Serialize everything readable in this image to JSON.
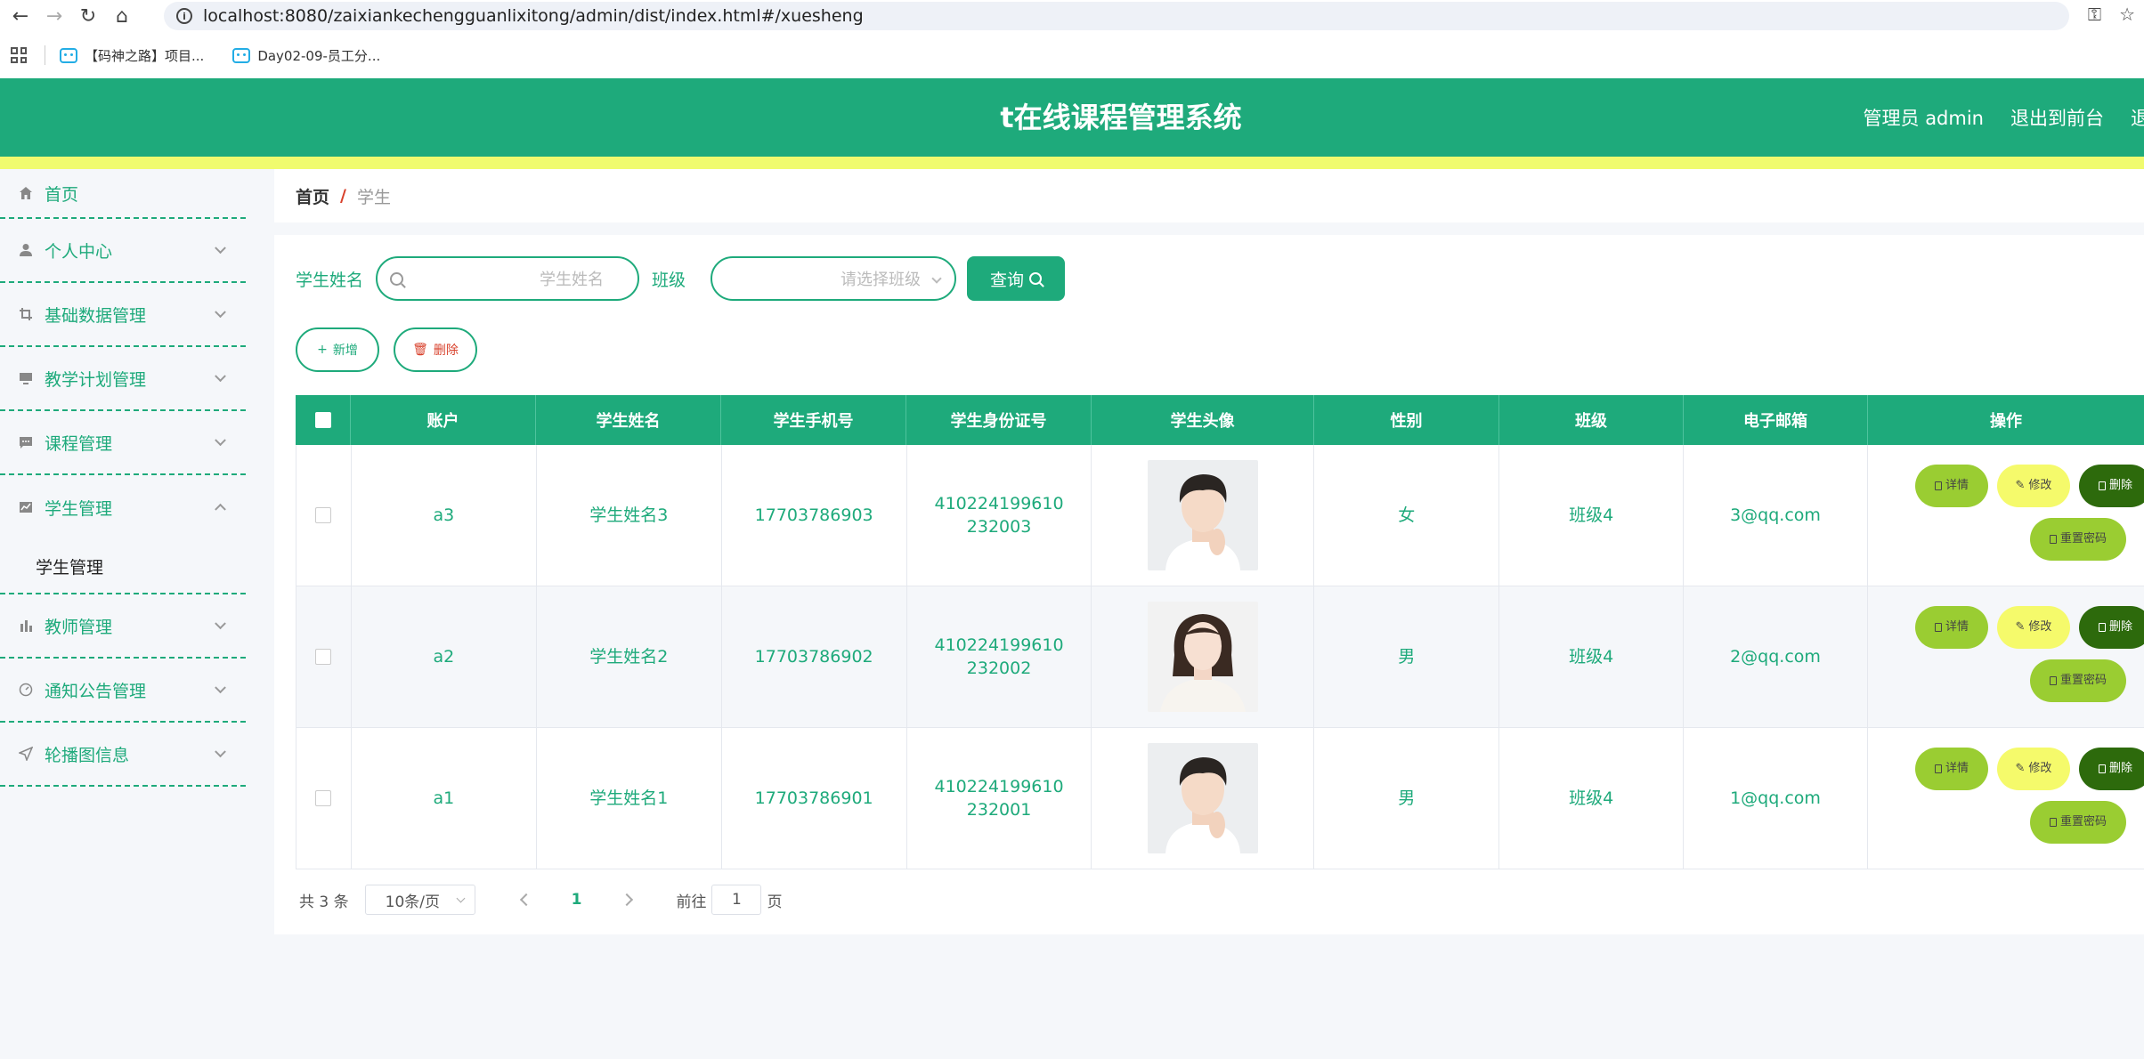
{
  "browser": {
    "url": "localhost:8080/zaixiankechengguanlixitong/admin/dist/index.html#/xuesheng",
    "bookmarks": [
      "【码神之路】项目...",
      "Day02-09-员工分..."
    ]
  },
  "header": {
    "title": "t在线课程管理系统",
    "user": "管理员 admin",
    "exit_front": "退出到前台",
    "exit": "退"
  },
  "sidebar": {
    "items": [
      {
        "label": "首页",
        "icon": "home-icon"
      },
      {
        "label": "个人中心",
        "icon": "user-icon"
      },
      {
        "label": "基础数据管理",
        "icon": "crop-icon"
      },
      {
        "label": "教学计划管理",
        "icon": "monitor-icon"
      },
      {
        "label": "课程管理",
        "icon": "chat-icon"
      },
      {
        "label": "学生管理",
        "icon": "chart-line-icon"
      },
      {
        "label": "教师管理",
        "icon": "bar-chart-icon"
      },
      {
        "label": "通知公告管理",
        "icon": "gauge-icon"
      },
      {
        "label": "轮播图信息",
        "icon": "location-icon"
      }
    ],
    "submenu": {
      "label": "学生管理"
    }
  },
  "breadcrumb": {
    "home": "首页",
    "sep": "/",
    "current": "学生"
  },
  "search": {
    "name_label": "学生姓名",
    "name_placeholder": "学生姓名",
    "class_label": "班级",
    "class_placeholder": "请选择班级",
    "query_label": "查询"
  },
  "actions": {
    "add": "新增",
    "delete": "删除"
  },
  "table": {
    "headers": [
      "账户",
      "学生姓名",
      "学生手机号",
      "学生身份证号",
      "学生头像",
      "性别",
      "班级",
      "电子邮箱",
      "操作"
    ],
    "rows": [
      {
        "account": "a3",
        "name": "学生姓名3",
        "phone": "17703786903",
        "id_card": "410224199610232003",
        "gender": "女",
        "class": "班级4",
        "email": "3@qq.com",
        "avatar": "male"
      },
      {
        "account": "a2",
        "name": "学生姓名2",
        "phone": "17703786902",
        "id_card": "410224199610232002",
        "gender": "男",
        "class": "班级4",
        "email": "2@qq.com",
        "avatar": "female"
      },
      {
        "account": "a1",
        "name": "学生姓名1",
        "phone": "17703786901",
        "id_card": "410224199610232001",
        "gender": "男",
        "class": "班级4",
        "email": "1@qq.com",
        "avatar": "male"
      }
    ],
    "op_labels": {
      "detail": "详情",
      "edit": "修改",
      "delete": "删除",
      "reset": "重置密码"
    }
  },
  "pagination": {
    "total": "共 3 条",
    "page_size": "10条/页",
    "current_page": "1",
    "goto_label": "前往",
    "goto_value": "1",
    "page_suffix": "页"
  },
  "colors": {
    "primary": "#1eaa7b",
    "accent_strip": "#f0fb6e",
    "detail_btn": "#9acd32",
    "edit_btn": "#f5fa6b",
    "delete_btn": "#2d6a0c"
  }
}
